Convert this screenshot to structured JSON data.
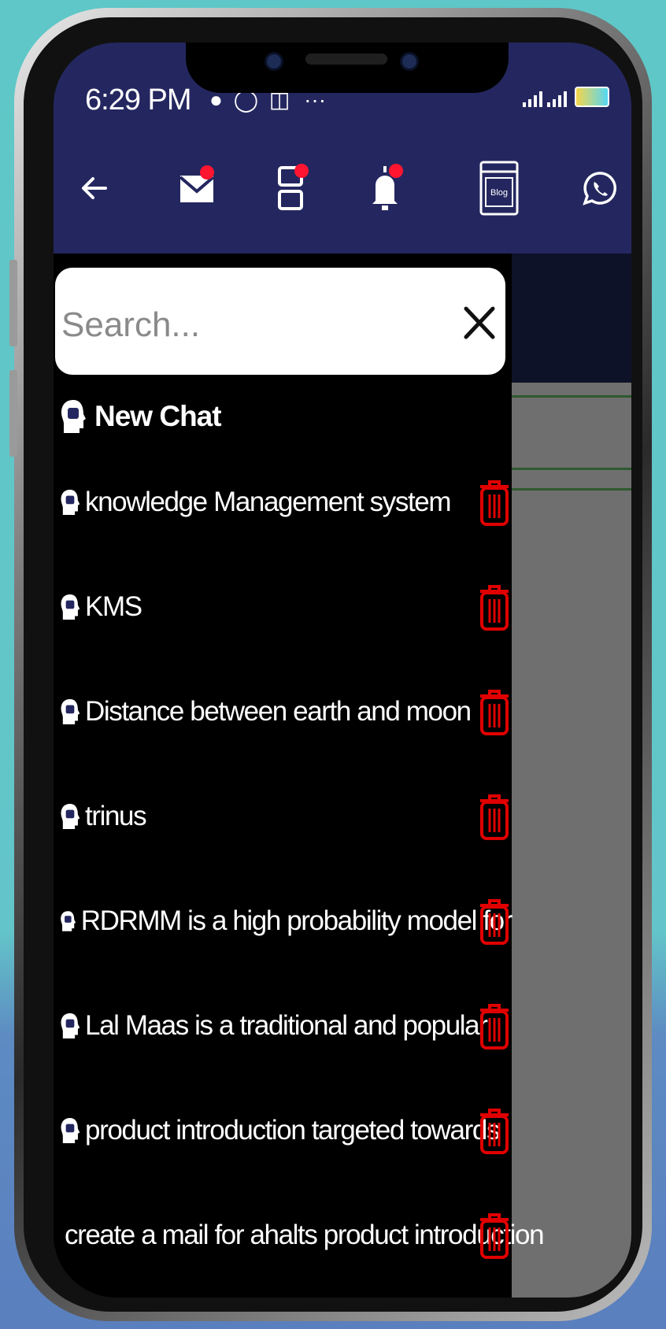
{
  "status_bar": {
    "time": "6:29 PM",
    "notification_icons": [
      "chat-bubble-icon",
      "whatsapp-icon",
      "app-icon",
      "more-dots-icon"
    ]
  },
  "toolbar": {
    "icons": [
      "back-arrow-icon",
      "mail-icon",
      "layout-icon",
      "bell-icon",
      "blog-icon",
      "whatsapp-icon"
    ],
    "blog_label": "Blog"
  },
  "search": {
    "placeholder": "Search...",
    "value": ""
  },
  "new_chat": {
    "label": "New Chat"
  },
  "chats": [
    {
      "title": "knowledge Management system"
    },
    {
      "title": "KMS"
    },
    {
      "title": "Distance between earth and moon"
    },
    {
      "title": "trinus"
    },
    {
      "title": "RDRMM is a high probability model for"
    },
    {
      "title": " Lal Maas is a traditional and popular"
    },
    {
      "title": "product introduction targeted towards"
    },
    {
      "title": "create a mail for ahalts product introduction"
    }
  ],
  "colors": {
    "app_bar": "#24275f",
    "drawer_bg": "#000000",
    "badge": "#ff1530",
    "delete_icon": "#e00000"
  }
}
